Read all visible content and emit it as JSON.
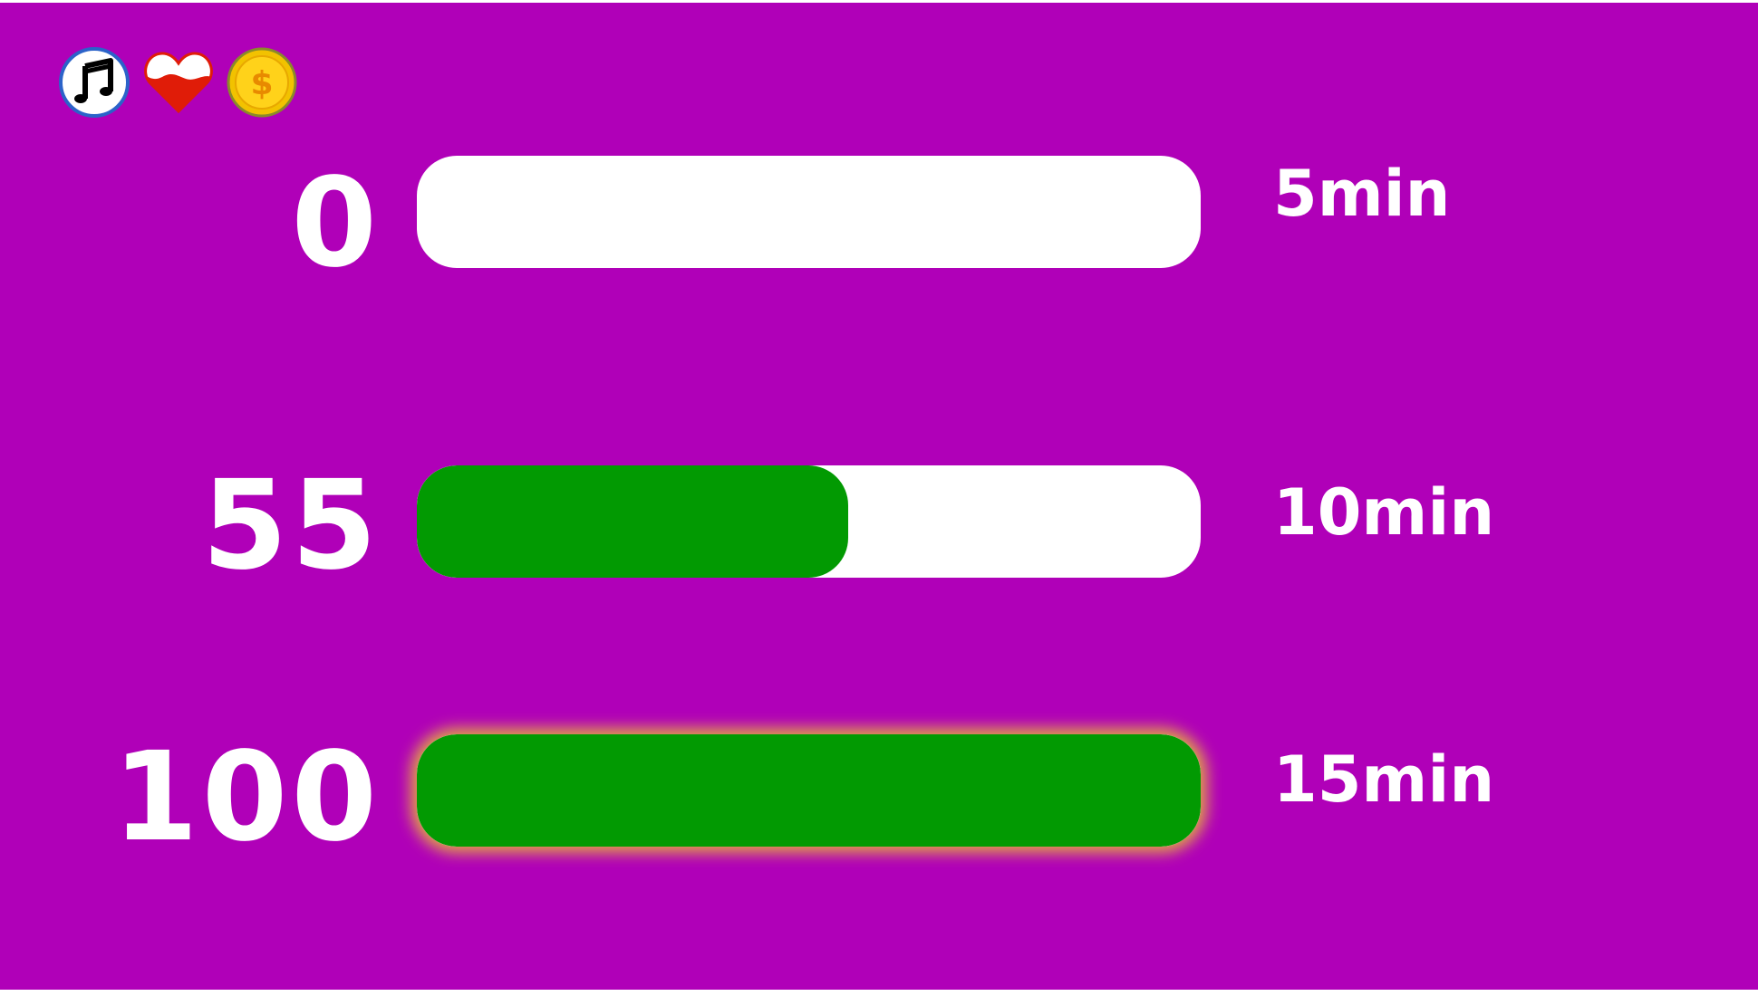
{
  "icons": [
    {
      "name": "music-icon",
      "colors": {
        "border": "#2b63c9",
        "fill": "#ffffff",
        "glyph": "#000000"
      }
    },
    {
      "name": "heart-icon",
      "colors": {
        "border": "#e01c08",
        "top": "#ffffff",
        "bottom": "#e01c08"
      }
    },
    {
      "name": "coin-icon",
      "colors": {
        "outer": "#f2c200",
        "inner": "#ffd21a",
        "border": "#8a8a2a",
        "glyph": "#e88a00"
      }
    }
  ],
  "colors": {
    "background": "#b000b8",
    "track": "#ffffff",
    "fill": "#029a02",
    "glow": "#e0a347",
    "text": "#ffffff"
  },
  "rows": [
    {
      "value": "0",
      "progress": 0.0,
      "time": "5min",
      "complete": false
    },
    {
      "value": "55",
      "progress": 0.55,
      "time": "10min",
      "complete": false
    },
    {
      "value": "100",
      "progress": 1.0,
      "time": "15min",
      "complete": true
    }
  ]
}
